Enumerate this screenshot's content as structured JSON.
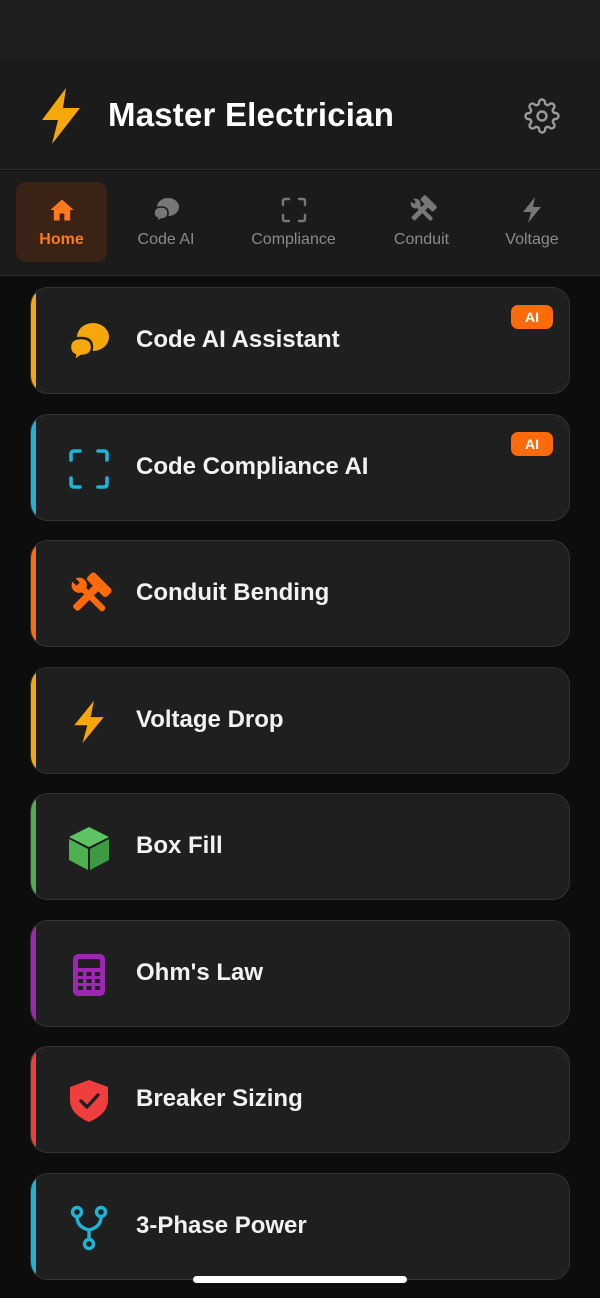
{
  "app": {
    "title": "Master Electrician"
  },
  "tabs": [
    {
      "label": "Home",
      "icon": "home-icon",
      "active": true
    },
    {
      "label": "Code AI",
      "icon": "chat-bubbles-icon"
    },
    {
      "label": "Compliance",
      "icon": "scan-frame-icon"
    },
    {
      "label": "Conduit",
      "icon": "tools-icon"
    },
    {
      "label": "Voltage",
      "icon": "bolt-icon"
    }
  ],
  "cards": [
    {
      "label": "Code AI Assistant",
      "icon": "chat-bubbles-icon",
      "accent": "#f5a70b",
      "badge": "AI"
    },
    {
      "label": "Code Compliance AI",
      "icon": "scan-frame-icon",
      "accent": "#1cb5d8",
      "badge": "AI"
    },
    {
      "label": "Conduit Bending",
      "icon": "tools-icon",
      "accent": "#ff6a0a"
    },
    {
      "label": "Voltage Drop",
      "icon": "bolt-icon",
      "accent": "#f5a70b"
    },
    {
      "label": "Box Fill",
      "icon": "cube-icon",
      "accent": "#4caf50"
    },
    {
      "label": "Ohm's Law",
      "icon": "calculator-icon",
      "accent": "#9c27b0"
    },
    {
      "label": "Breaker Sizing",
      "icon": "shield-check-icon",
      "accent": "#f03e3e"
    },
    {
      "label": "3-Phase Power",
      "icon": "branch-icon",
      "accent": "#1cb5d8"
    }
  ],
  "colors": {
    "accent": "#ff7a1a",
    "bolt": "#f5a70b"
  }
}
